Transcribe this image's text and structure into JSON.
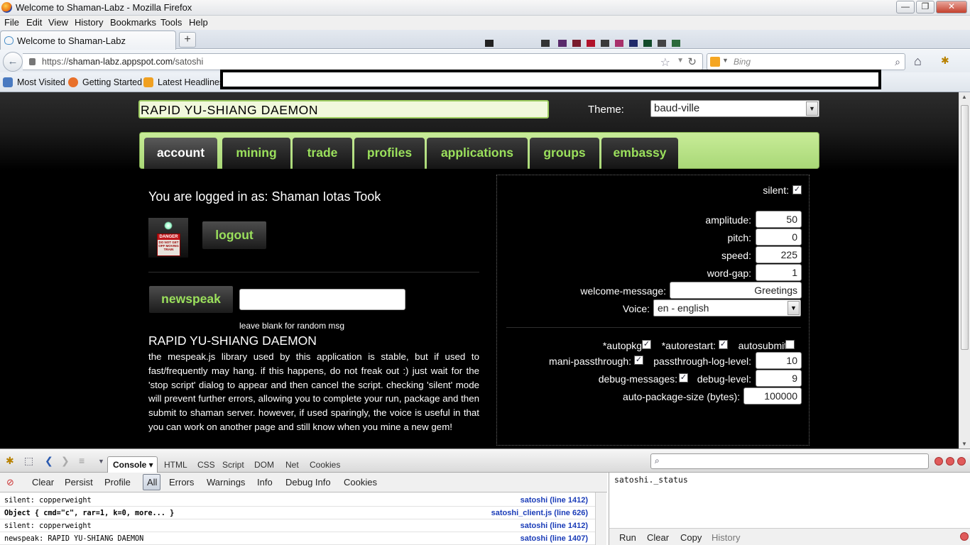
{
  "window": {
    "title": "Welcome to Shaman-Labz - Mozilla Firefox",
    "minimize": "—",
    "maximize": "❐",
    "close": "✕"
  },
  "menu": [
    "File",
    "Edit",
    "View",
    "History",
    "Bookmarks",
    "Tools",
    "Help"
  ],
  "tab": {
    "label": "Welcome to Shaman-Labz",
    "close": "×",
    "new": "+"
  },
  "nav": {
    "url_prefix": "https://",
    "url_host": "shaman-labz.appspot.com",
    "url_path": "/satoshi",
    "search_placeholder": "Bing"
  },
  "bookmarks": [
    "Most Visited",
    "Getting Started",
    "Latest Headlines"
  ],
  "page": {
    "title_field": "RAPID YU-SHIANG DAEMON",
    "theme_label": "Theme:",
    "theme_value": "baud-ville",
    "tabs": [
      "account",
      "mining",
      "trade",
      "profiles",
      "applications",
      "groups",
      "embassy"
    ],
    "logged_in": "You are logged in as: Shaman Iotas Took",
    "avatar_sign": {
      "head": "DANGER",
      "text": "DO NOT GET OFF MOVING TRAIN"
    },
    "logout": "logout",
    "newspeak": "newspeak",
    "newspeak_hint": "leave blank for random msg",
    "desc_title": "RAPID YU-SHIANG DAEMON",
    "desc": "the mespeak.js library used by this application is stable, but if used to fast/frequently may hang. if this happens, do not freak out :) just wait for the 'stop script' dialog to appear and then cancel the script. checking 'silent' mode will prevent further errors, allowing you to complete your run, package and then submit to shaman server. however, if used sparingly, the voice is useful in that you can work on another page and still know when you mine a new gem!",
    "settings": {
      "silent_label": "silent:",
      "silent": true,
      "amplitude_label": "amplitude:",
      "amplitude": "50",
      "pitch_label": "pitch:",
      "pitch": "0",
      "speed_label": "speed:",
      "speed": "225",
      "word_gap_label": "word-gap:",
      "word_gap": "1",
      "welcome_label": "welcome-message:",
      "welcome": "Greetings",
      "voice_label": "Voice:",
      "voice": "en - english",
      "autopkg_label": "*autopkg:",
      "autopkg": true,
      "autorestart_label": "*autorestart:",
      "autorestart": true,
      "autosubmit_label": "autosubmit:",
      "autosubmit": false,
      "mani_label": "mani-passthrough:",
      "mani": true,
      "pt_level_label": "passthrough-log-level:",
      "pt_level": "10",
      "debug_msgs_label": "debug-messages:",
      "debug_msgs": true,
      "debug_level_label": "debug-level:",
      "debug_level": "9",
      "pkg_size_label": "auto-package-size (bytes):",
      "pkg_size": "100000"
    }
  },
  "firebug": {
    "panel": "Console",
    "tabs": [
      "HTML",
      "CSS",
      "Script",
      "DOM",
      "Net",
      "Cookies"
    ],
    "filters": [
      "Clear",
      "Persist",
      "Profile",
      "All",
      "Errors",
      "Warnings",
      "Info",
      "Debug Info",
      "Cookies"
    ],
    "log": [
      {
        "msg": "silent: copperweight",
        "src": "satoshi (line 1412)"
      },
      {
        "msg": "Object { cmd=\"c\",  rar=1,  k=0,  more... }",
        "src": "satoshi_client.js (line 626)"
      },
      {
        "msg": "silent: copperweight",
        "src": "satoshi (line 1412)"
      },
      {
        "msg": "newspeak: RAPID YU-SHIANG DAEMON",
        "src": "satoshi (line 1407)"
      }
    ],
    "command": "satoshi._status",
    "cmd_buttons": [
      "Run",
      "Clear",
      "Copy",
      "History"
    ]
  },
  "colors": {
    "accent_green": "#9be05c",
    "tab_strip": "#b8e288",
    "link_blue": "#1a3cb8"
  }
}
